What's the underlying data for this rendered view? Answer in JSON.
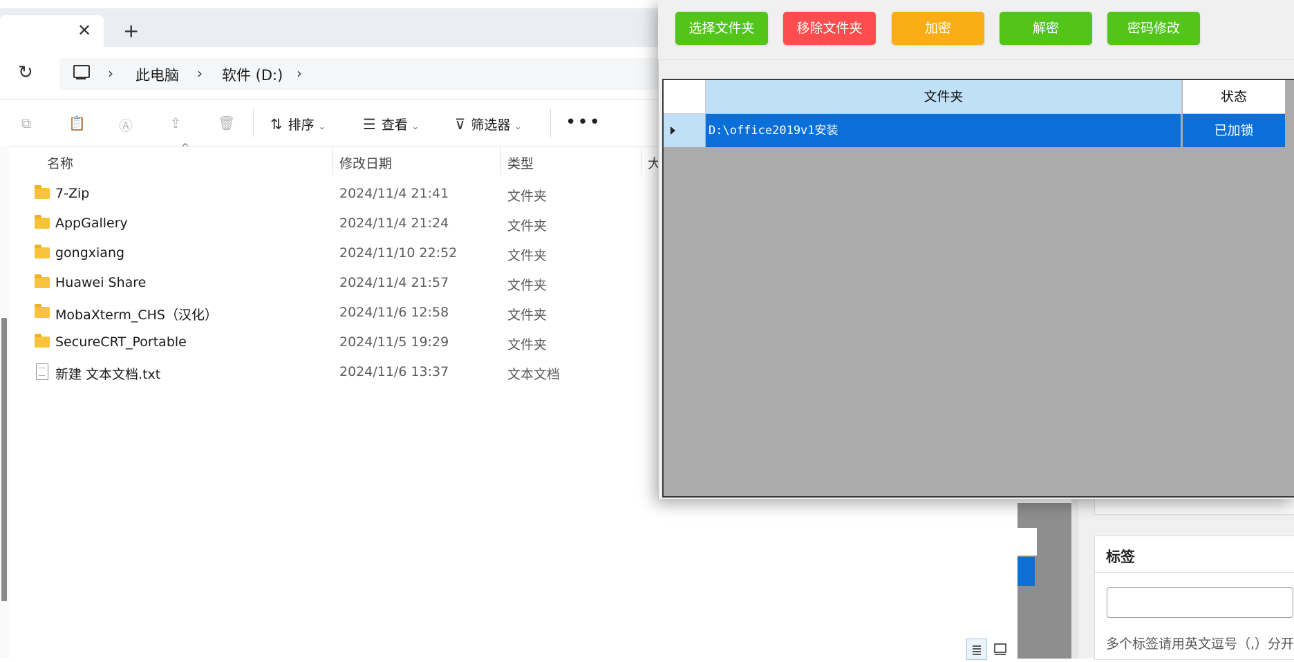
{
  "explorer": {
    "breadcrumb": [
      "此电脑",
      "软件 (D:)"
    ],
    "commands": {
      "sort": "排序",
      "view": "查看",
      "filter": "筛选器",
      "more": "•••"
    },
    "columns": {
      "name": "名称",
      "date": "修改日期",
      "type": "类型",
      "size": "大"
    },
    "files": [
      {
        "name": "7-Zip",
        "date": "2024/11/4 21:41",
        "type": "文件夹",
        "kind": "folder"
      },
      {
        "name": "AppGallery",
        "date": "2024/11/4 21:24",
        "type": "文件夹",
        "kind": "folder"
      },
      {
        "name": "gongxiang",
        "date": "2024/11/10 22:52",
        "type": "文件夹",
        "kind": "folder"
      },
      {
        "name": "Huawei Share",
        "date": "2024/11/4 21:57",
        "type": "文件夹",
        "kind": "folder"
      },
      {
        "name": "MobaXterm_CHS（汉化）",
        "date": "2024/11/6 12:58",
        "type": "文件夹",
        "kind": "folder"
      },
      {
        "name": "SecureCRT_Portable",
        "date": "2024/11/5 19:29",
        "type": "文件夹",
        "kind": "folder"
      },
      {
        "name": "新建 文本文档.txt",
        "date": "2024/11/6 13:37",
        "type": "文本文档",
        "kind": "file"
      }
    ]
  },
  "tool": {
    "buttons": [
      {
        "label": "选择文件夹",
        "color": "#52c41a"
      },
      {
        "label": "移除文件夹",
        "color": "#ff4d4f"
      },
      {
        "label": "加密",
        "color": "#faad14"
      },
      {
        "label": "解密",
        "color": "#52c41a"
      },
      {
        "label": "密码修改",
        "color": "#52c41a"
      }
    ],
    "grid": {
      "col_folder": "文件夹",
      "col_state": "状态",
      "rows": [
        {
          "path": "D:\\office2019v1安装",
          "state": "已加锁"
        }
      ]
    }
  },
  "background_panel": {
    "title": "标签",
    "hint": "多个标签请用英文逗号（,）分开"
  }
}
